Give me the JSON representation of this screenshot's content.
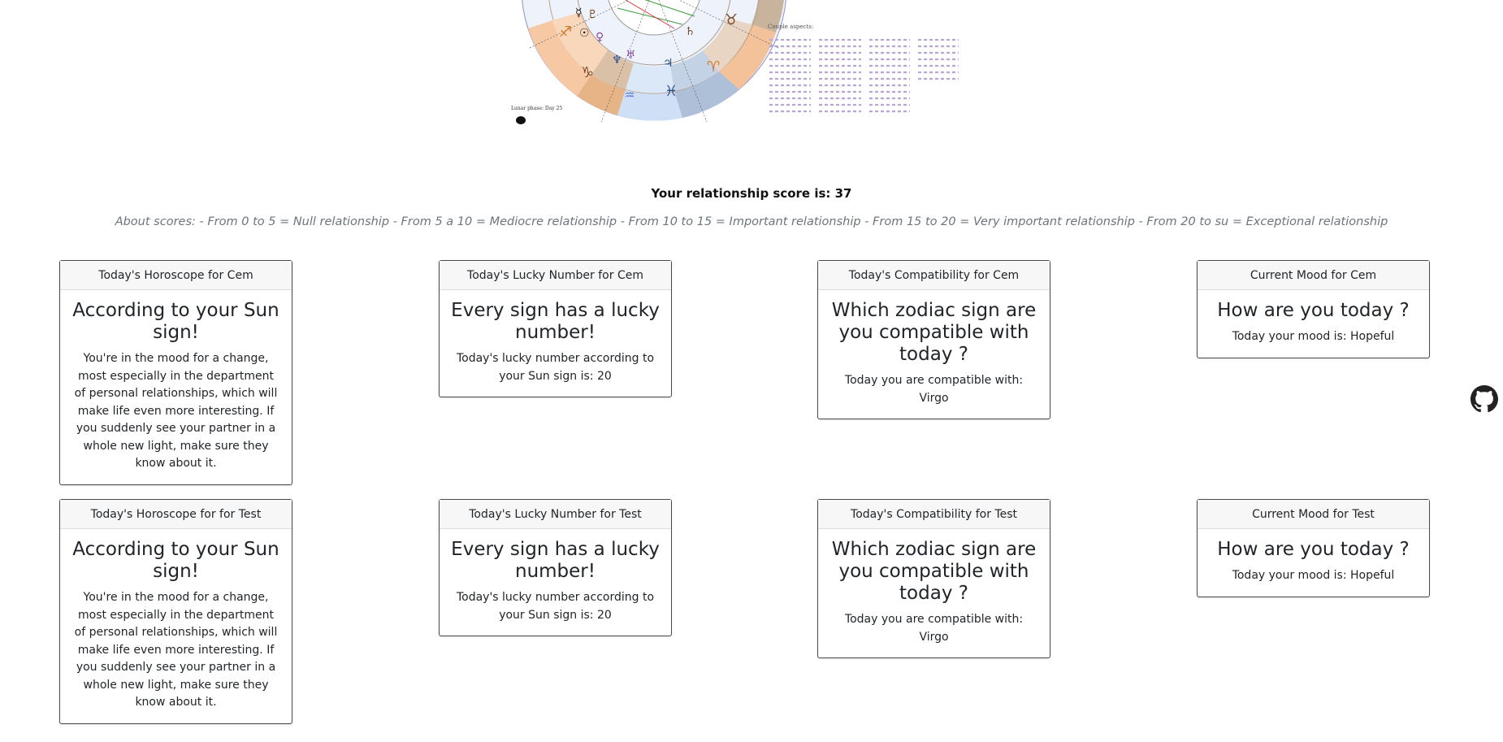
{
  "chart": {
    "lunar_phase_label": "Lunar phase: Day 25",
    "aspects_title": "Couple aspects:"
  },
  "score_text": "Your relationship score is: 37",
  "about_text": "About scores: - From 0 to 5 = Null relationship - From 5 a 10 = Mediocre relationship - From 10 to 15 = Important relationship - From 15 to 20 = Very important relationship - From 20 to su = Exceptional relationship",
  "rows": [
    {
      "horoscope": {
        "header": "Today's Horoscope for Cem",
        "title": "According to your Sun sign!",
        "text": "You're in the mood for a change, most especially in the department of personal relationships, which will make life even more interesting. If you suddenly see your partner in a whole new light, make sure they know about it."
      },
      "lucky": {
        "header": "Today's Lucky Number for Cem",
        "title": "Every sign has a lucky number!",
        "text": "Today's lucky number according to your Sun sign is: 20"
      },
      "compat": {
        "header": "Today's Compatibility for Cem",
        "title": "Which zodiac sign are you compatible with today ?",
        "text": "Today you are compatible with: Virgo"
      },
      "mood": {
        "header": "Current Mood for Cem",
        "title": "How are you today ?",
        "text": "Today your mood is: Hopeful"
      }
    },
    {
      "horoscope": {
        "header": "Today's Horoscope for for Test",
        "title": "According to your Sun sign!",
        "text": "You're in the mood for a change, most especially in the department of personal relationships, which will make life even more interesting. If you suddenly see your partner in a whole new light, make sure they know about it."
      },
      "lucky": {
        "header": "Today's Lucky Number for Test",
        "title": "Every sign has a lucky number!",
        "text": "Today's lucky number according to your Sun sign is: 20"
      },
      "compat": {
        "header": "Today's Compatibility for Test",
        "title": "Which zodiac sign are you compatible with today ?",
        "text": "Today you are compatible with: Virgo"
      },
      "mood": {
        "header": "Current Mood for Test",
        "title": "How are you today ?",
        "text": "Today your mood is: Hopeful"
      }
    }
  ],
  "colors": {
    "accent_orange": "#f7b98a",
    "wheel_blue": "#c9ddf5",
    "wheel_brown": "#b8a48e"
  },
  "icons": [
    "github-icon",
    "natal-chart-wheel",
    "moon-phase-icon"
  ]
}
